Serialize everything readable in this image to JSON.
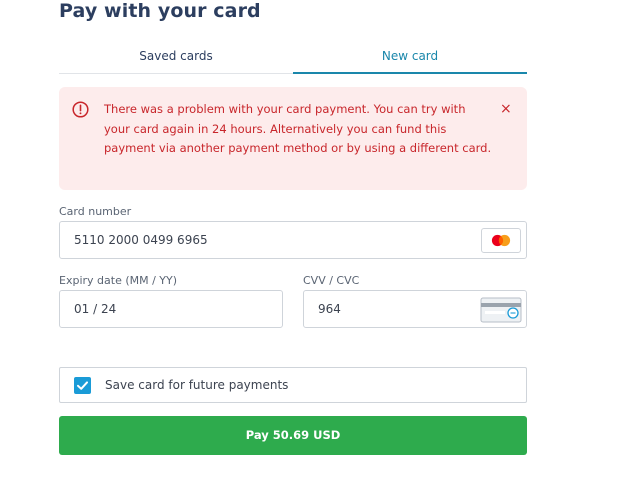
{
  "page": {
    "title": "Pay with your card"
  },
  "tabs": [
    {
      "label": "Saved cards",
      "active": false
    },
    {
      "label": "New card",
      "active": true
    }
  ],
  "alert": {
    "message": "There was a problem with your card payment. You can try with your card again in 24 hours. Alternatively you can fund this payment via another payment method or by using a different card.",
    "close_symbol": "×",
    "icon": "error-circle-icon"
  },
  "form": {
    "card_number": {
      "label": "Card number",
      "value": "5110 2000 0499 6965",
      "brand_icon": "mastercard-icon"
    },
    "expiry": {
      "label": "Expiry date (MM / YY)",
      "value": "01 / 24"
    },
    "cvv": {
      "label": "CVV / CVC",
      "value": "964",
      "icon": "card-back-cvc-icon"
    },
    "save_card": {
      "label": "Save card for future payments",
      "checked": true
    }
  },
  "pay_button": {
    "label": "Pay 50.69 USD"
  },
  "colors": {
    "title": "#2c3e5f",
    "accent": "#1a87ab",
    "error": "#c8262b",
    "error_bg": "#fdecec",
    "checkbox": "#1a9bd7",
    "pay_button": "#2eab4d"
  }
}
